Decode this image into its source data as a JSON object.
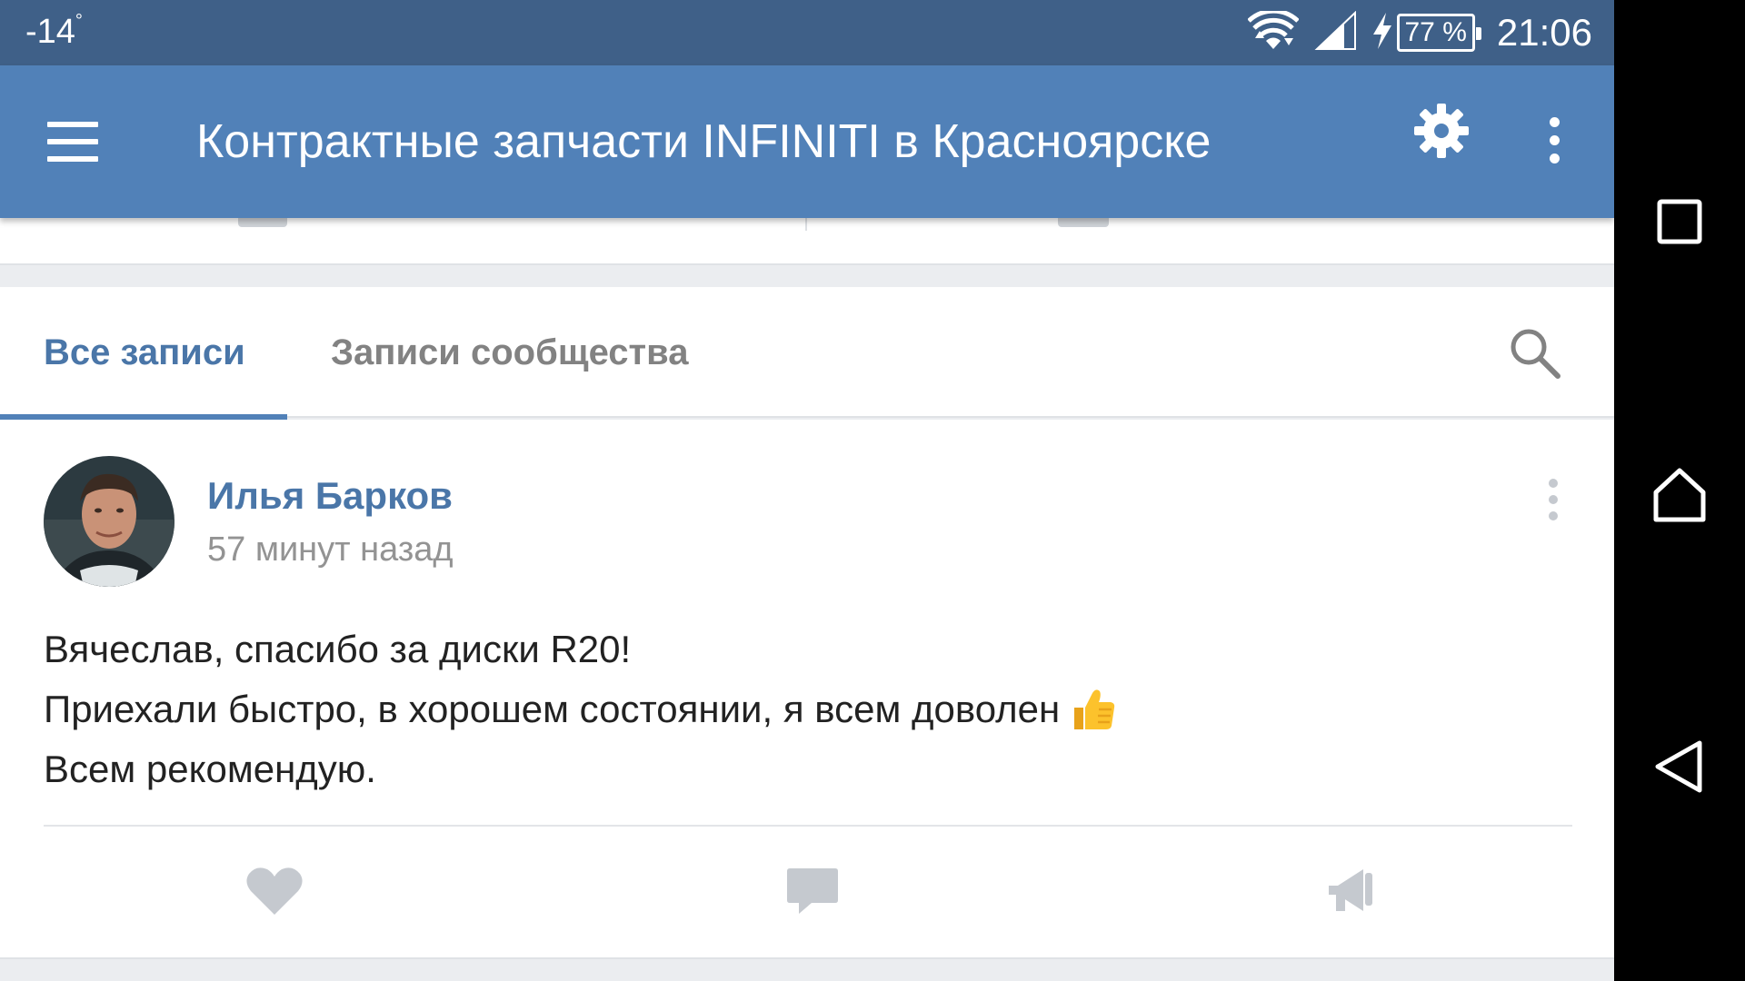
{
  "status_bar": {
    "temperature": "-14",
    "temperature_unit": "°",
    "battery": "77 %",
    "time": "21:06"
  },
  "toolbar": {
    "title": "Контрактные запчасти INFINITI в Красноярске"
  },
  "tabs": [
    {
      "label": "Все записи",
      "active": true
    },
    {
      "label": "Записи сообщества",
      "active": false
    }
  ],
  "post": {
    "author": "Илья Барков",
    "time": "57 минут назад",
    "lines": [
      "Вячеслав, спасибо за диски R20!",
      "Приехали быстро, в хорошем состоянии, я всем доволен",
      "Всем рекомендую."
    ],
    "emoji": "thumbs-up-icon"
  },
  "colors": {
    "status_bar": "#3f6088",
    "toolbar": "#5181b8",
    "accent": "#4a76a8",
    "inactive_tab": "#828282",
    "action_icon": "#c5c9cf",
    "navbar": "#000000"
  }
}
